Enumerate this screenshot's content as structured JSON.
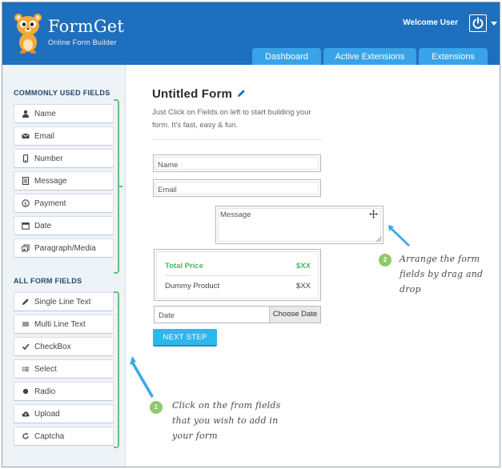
{
  "header": {
    "brand": "FormGet",
    "tagline": "Online Form Builder",
    "welcome": "Welcome User",
    "accent_color": "#1e6fbd",
    "tabs": [
      {
        "label": "Dashboard"
      },
      {
        "label": "Active Extensions"
      },
      {
        "label": "Extensions"
      }
    ]
  },
  "sidebar": {
    "common_title": "COMMONLY USED FIELDS",
    "common_fields": [
      {
        "label": "Name",
        "icon": "user-icon"
      },
      {
        "label": "Email",
        "icon": "envelope-icon"
      },
      {
        "label": "Number",
        "icon": "phone-icon"
      },
      {
        "label": "Message",
        "icon": "message-icon"
      },
      {
        "label": "Payment",
        "icon": "payment-icon"
      },
      {
        "label": "Date",
        "icon": "calendar-icon"
      },
      {
        "label": "Paragraph/Media",
        "icon": "paragraph-icon"
      }
    ],
    "all_title": "ALL FORM FIELDS",
    "all_fields": [
      {
        "label": "Single Line Text",
        "icon": "pencil-icon"
      },
      {
        "label": "Multi Line Text",
        "icon": "lines-icon"
      },
      {
        "label": "CheckBox",
        "icon": "check-icon"
      },
      {
        "label": "Select",
        "icon": "list-icon"
      },
      {
        "label": "Radio",
        "icon": "radio-icon"
      },
      {
        "label": "Upload",
        "icon": "upload-icon"
      },
      {
        "label": "Captcha",
        "icon": "refresh-icon"
      }
    ]
  },
  "form": {
    "title": "Untitled Form",
    "description": "Just Click on Fields on left to start building your form. It's fast, easy & fun.",
    "name_placeholder": "Name",
    "email_placeholder": "Email",
    "message_placeholder": "Message",
    "total_label": "Total Price",
    "total_value": "$XX",
    "product_label": "Dummy Product",
    "product_value": "$XX",
    "date_placeholder": "Date",
    "choose_date": "Choose Date",
    "next_step": "NEXT STEP"
  },
  "hints": {
    "hint1_number": "1",
    "hint1_text": "Click on the from fields that you wish to add in your form",
    "hint2_number": "2",
    "hint2_text": "Arrange the form fields by drag and drop"
  }
}
